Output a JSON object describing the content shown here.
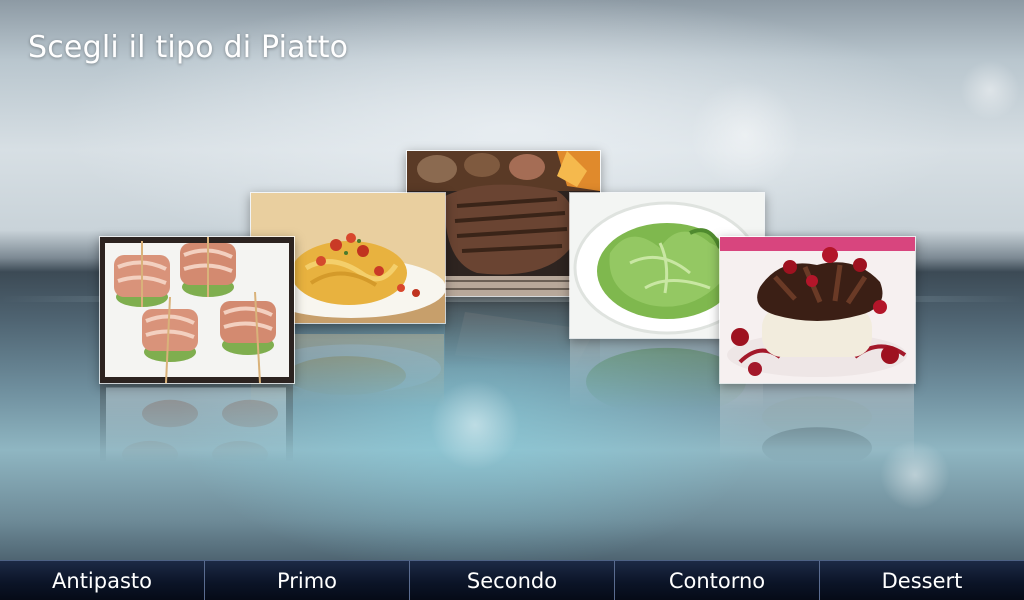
{
  "page": {
    "title": "Scegli il tipo di Piatto"
  },
  "dishes": [
    {
      "id": "antipasto",
      "image": "bacon-wrapped-cucumber-rolls-image"
    },
    {
      "id": "primo",
      "image": "pasta-with-tomato-image"
    },
    {
      "id": "secondo",
      "image": "grilled-steak-image"
    },
    {
      "id": "contorno",
      "image": "green-salad-image"
    },
    {
      "id": "dessert",
      "image": "chocolate-cherry-dessert-image"
    }
  ],
  "tabs": [
    {
      "label": "Antipasto"
    },
    {
      "label": "Primo"
    },
    {
      "label": "Secondo"
    },
    {
      "label": "Contorno"
    },
    {
      "label": "Dessert"
    }
  ],
  "colors": {
    "tabbar_bg": "#0b1427",
    "tab_divider": "#5a6c90",
    "text": "#ffffff"
  }
}
